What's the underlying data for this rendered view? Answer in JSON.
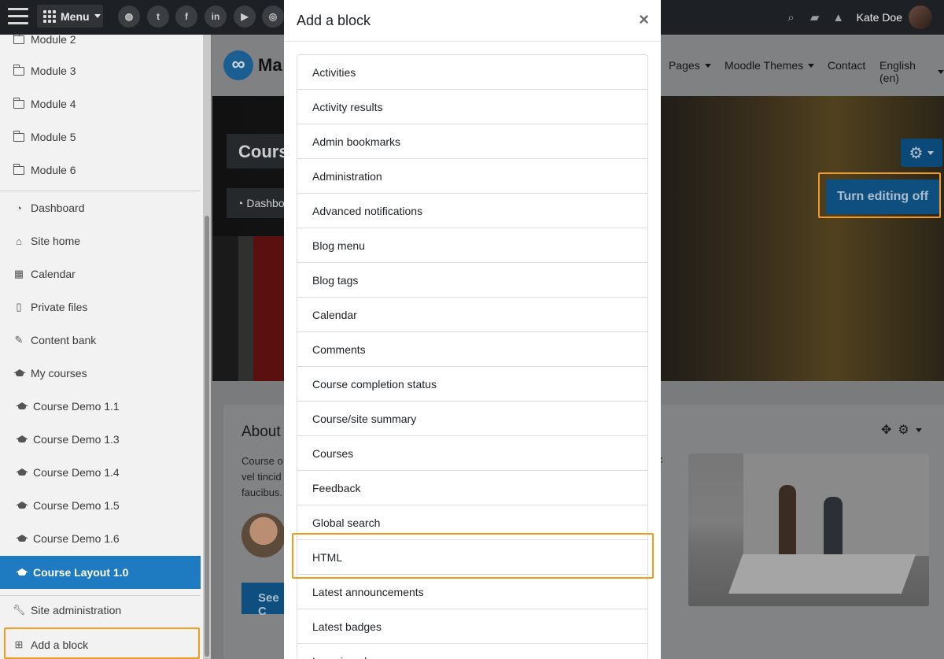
{
  "topbar": {
    "menu_label": "Menu",
    "social_icons": [
      "globe-icon",
      "twitter-icon",
      "facebook-icon",
      "linkedin-icon",
      "youtube-icon",
      "instagram-icon"
    ],
    "user_name": "Kate Doe"
  },
  "sidebar": {
    "modules": [
      {
        "label": "Module 2"
      },
      {
        "label": "Module 3"
      },
      {
        "label": "Module 4"
      },
      {
        "label": "Module 5"
      },
      {
        "label": "Module 6"
      }
    ],
    "nav": [
      {
        "label": "Dashboard",
        "icon": "dashboard-icon"
      },
      {
        "label": "Site home",
        "icon": "home-icon"
      },
      {
        "label": "Calendar",
        "icon": "calendar-icon"
      },
      {
        "label": "Private files",
        "icon": "file-icon"
      },
      {
        "label": "Content bank",
        "icon": "brush-icon"
      },
      {
        "label": "My courses",
        "icon": "graduation-cap-icon"
      }
    ],
    "courses": [
      {
        "label": "Course Demo 1.1"
      },
      {
        "label": "Course Demo 1.3"
      },
      {
        "label": "Course Demo 1.4"
      },
      {
        "label": "Course Demo 1.5"
      },
      {
        "label": "Course Demo 1.6"
      },
      {
        "label": "Course Layout 1.0"
      }
    ],
    "site_admin": "Site administration",
    "add_block": "Add a block"
  },
  "main": {
    "logo_text": "Ma",
    "nav_links": [
      "Pages",
      "Moodle Themes",
      "Contact",
      "English (en)"
    ],
    "hero_title": "Cours",
    "hero_dashboard": "Dashbo",
    "turn_editing": "Turn editing off",
    "about_title": "About",
    "about_text_lines": [
      "Course o",
      "vel tincid",
      "faucibus."
    ],
    "about_text_right": "c",
    "see_button": "See C"
  },
  "modal": {
    "title": "Add a block",
    "close": "×",
    "blocks": [
      "Activities",
      "Activity results",
      "Admin bookmarks",
      "Administration",
      "Advanced notifications",
      "Blog menu",
      "Blog tags",
      "Calendar",
      "Comments",
      "Course completion status",
      "Course/site summary",
      "Courses",
      "Feedback",
      "Global search",
      "HTML",
      "Latest announcements",
      "Latest badges",
      "Learning plans"
    ]
  },
  "colors": {
    "accent": "#1f7bc1",
    "highlight": "#f29b1d",
    "topbar": "#1d2125"
  }
}
